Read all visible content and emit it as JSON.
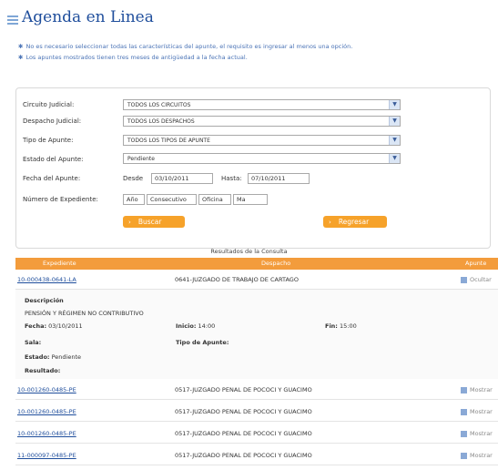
{
  "header": {
    "title": "Agenda en Linea"
  },
  "notes": [
    "No es necesario seleccionar todas las características del apunte, el requisito es ingresar al menos una opción.",
    "Los apuntes mostrados tienen tres meses de antigüedad a la fecha actual."
  ],
  "form": {
    "circuito_label": "Circuito Judicial:",
    "circuito_value": "TODOS LOS CIRCUITOS",
    "despacho_label": "Despacho Judicial:",
    "despacho_value": "TODOS LOS DESPACHOS",
    "tipo_label": "Tipo de Apunte:",
    "tipo_value": "TODOS LOS TIPOS DE APUNTE",
    "estado_label": "Estado del Apunte:",
    "estado_value": "Pendiente",
    "fecha_label": "Fecha del Apunte:",
    "desde_label": "Desde",
    "desde_value": "03/10/2011",
    "hasta_label": "Hasta:",
    "hasta_value": "07/10/2011",
    "expediente_label": "Número de Expediente:",
    "exp_fields": [
      "Año",
      "Consecutivo",
      "Oficina",
      "Ma"
    ],
    "buscar_label": "Buscar",
    "regresar_label": "Regresar"
  },
  "results": {
    "title": "Resultados de la Consulta",
    "columns": [
      "Expediente",
      "Despacho",
      "Apunte"
    ],
    "rows": [
      {
        "expediente": "10-000438-0641-LA",
        "despacho": "0641-JUZGADO DE TRABAJO DE CARTAGO",
        "action": "Ocultar"
      },
      {
        "expediente": "10-001260-0485-PE",
        "despacho": "0517-JUZGADO PENAL DE POCOCI Y GUACIMO",
        "action": "Mostrar"
      },
      {
        "expediente": "10-001260-0485-PE",
        "despacho": "0517-JUZGADO PENAL DE POCOCI Y GUACIMO",
        "action": "Mostrar"
      },
      {
        "expediente": "10-001260-0485-PE",
        "despacho": "0517-JUZGADO PENAL DE POCOCI Y GUACIMO",
        "action": "Mostrar"
      },
      {
        "expediente": "11-000097-0485-PE",
        "despacho": "0517-JUZGADO PENAL DE POCOCI Y GUACIMO",
        "action": "Mostrar"
      }
    ],
    "detail": {
      "descripcion_label": "Descripción",
      "descripcion_value": "PENSIÓN Y RÉGIMEN NO CONTRIBUTIVO",
      "fecha_label": "Fecha:",
      "fecha_value": "03/10/2011",
      "inicio_label": "Inicio:",
      "inicio_value": "14:00",
      "fin_label": "Fin:",
      "fin_value": "15:00",
      "sala_label": "Sala:",
      "tipo_label": "Tipo de Apunte:",
      "estado_label": "Estado:",
      "estado_value": "Pendiente",
      "resultado_label": "Resultado:"
    }
  }
}
